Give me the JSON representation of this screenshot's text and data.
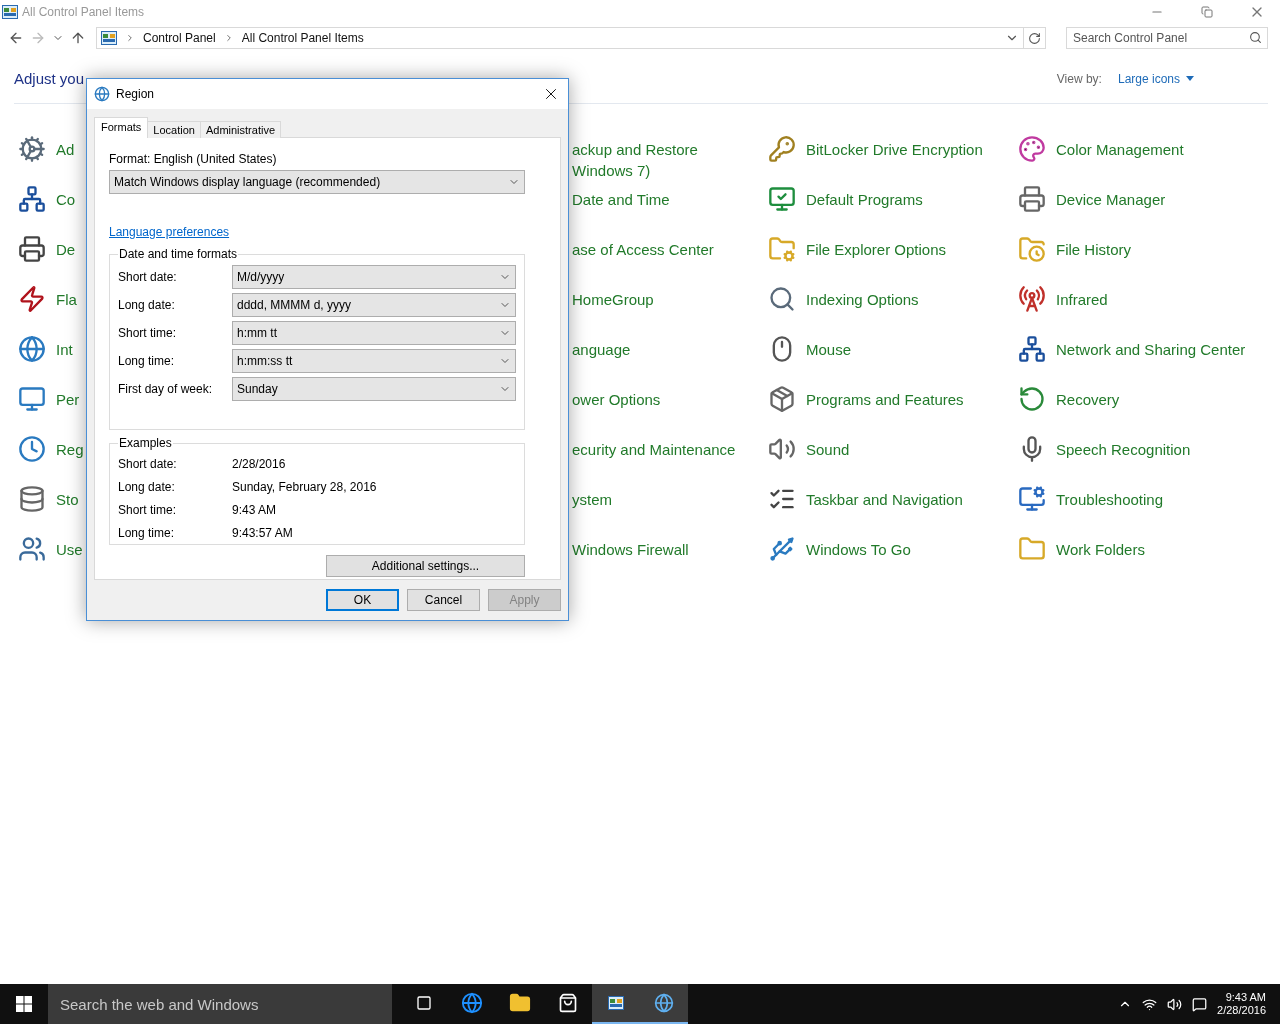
{
  "window": {
    "title": "All Control Panel Items"
  },
  "address_bar": {
    "breadcrumbs": [
      "Control Panel",
      "All Control Panel Items"
    ]
  },
  "search": {
    "placeholder": "Search Control Panel"
  },
  "heading": "Adjust you",
  "view_by": {
    "label": "View by:",
    "value": "Large icons"
  },
  "items": [
    {
      "label": "Ad",
      "kind": "icon"
    },
    {
      "label": "ackup and Restore\nWindows 7)",
      "kind": "text"
    },
    {
      "label": "BitLocker Drive Encryption",
      "kind": "icon"
    },
    {
      "label": "Color Management",
      "kind": "icon"
    },
    {
      "label": "Co",
      "kind": "icon"
    },
    {
      "label": "Date and Time",
      "kind": "text"
    },
    {
      "label": "Default Programs",
      "kind": "icon"
    },
    {
      "label": "Device Manager",
      "kind": "icon"
    },
    {
      "label": "De",
      "kind": "icon"
    },
    {
      "label": "ase of Access Center",
      "kind": "text"
    },
    {
      "label": "File Explorer Options",
      "kind": "icon"
    },
    {
      "label": "File History",
      "kind": "icon"
    },
    {
      "label": "Fla",
      "kind": "icon"
    },
    {
      "label": "HomeGroup",
      "kind": "text"
    },
    {
      "label": "Indexing Options",
      "kind": "icon"
    },
    {
      "label": "Infrared",
      "kind": "icon"
    },
    {
      "label": "Int",
      "kind": "icon"
    },
    {
      "label": "anguage",
      "kind": "text"
    },
    {
      "label": "Mouse",
      "kind": "icon"
    },
    {
      "label": "Network and Sharing Center",
      "kind": "icon"
    },
    {
      "label": "Per",
      "kind": "icon"
    },
    {
      "label": "ower Options",
      "kind": "text"
    },
    {
      "label": "Programs and Features",
      "kind": "icon"
    },
    {
      "label": "Recovery",
      "kind": "icon"
    },
    {
      "label": "Reg",
      "kind": "icon"
    },
    {
      "label": "ecurity and Maintenance",
      "kind": "text"
    },
    {
      "label": "Sound",
      "kind": "icon"
    },
    {
      "label": "Speech Recognition",
      "kind": "icon"
    },
    {
      "label": "Sto",
      "kind": "icon"
    },
    {
      "label": "ystem",
      "kind": "text"
    },
    {
      "label": "Taskbar and Navigation",
      "kind": "icon"
    },
    {
      "label": "Troubleshooting",
      "kind": "icon"
    },
    {
      "label": "Use",
      "kind": "icon"
    },
    {
      "label": "Windows Firewall",
      "kind": "text"
    },
    {
      "label": "Windows To Go",
      "kind": "icon"
    },
    {
      "label": "Work Folders",
      "kind": "icon"
    }
  ],
  "dialog": {
    "title": "Region",
    "tabs": [
      {
        "label": "Formats",
        "selected": true
      },
      {
        "label": "Location",
        "selected": false
      },
      {
        "label": "Administrative",
        "selected": false
      }
    ],
    "format_label": "Format: English (United States)",
    "format_value": "Match Windows display language (recommended)",
    "link": "Language preferences",
    "formats_group": {
      "title": "Date and time formats",
      "rows": [
        {
          "label": "Short date:",
          "value": "M/d/yyyy"
        },
        {
          "label": "Long date:",
          "value": "dddd, MMMM d, yyyy"
        },
        {
          "label": "Short time:",
          "value": "h:mm tt"
        },
        {
          "label": "Long time:",
          "value": "h:mm:ss tt"
        },
        {
          "label": "First day of week:",
          "value": "Sunday"
        }
      ]
    },
    "examples_group": {
      "title": "Examples",
      "rows": [
        {
          "label": "Short date:",
          "value": "2/28/2016"
        },
        {
          "label": "Long date:",
          "value": "Sunday, February 28, 2016"
        },
        {
          "label": "Short time:",
          "value": "9:43 AM"
        },
        {
          "label": "Long time:",
          "value": "9:43:57 AM"
        }
      ]
    },
    "additional_button": "Additional settings...",
    "buttons": [
      {
        "label": "OK",
        "default": true,
        "disabled": false
      },
      {
        "label": "Cancel",
        "default": false,
        "disabled": false
      },
      {
        "label": "Apply",
        "default": false,
        "disabled": true
      }
    ]
  },
  "taskbar": {
    "search_placeholder": "Search the web and Windows",
    "apps": [
      {
        "kind": "edge",
        "active": false
      },
      {
        "kind": "explorer",
        "active": false
      },
      {
        "kind": "store",
        "active": false
      },
      {
        "kind": "control_panel",
        "active": true
      },
      {
        "kind": "region",
        "active": true
      }
    ],
    "clock": {
      "time": "9:43 AM",
      "date": "2/28/2016"
    }
  }
}
